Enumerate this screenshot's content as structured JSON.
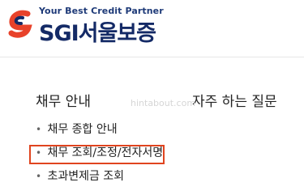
{
  "brand": {
    "tagline": "Your Best Credit Partner",
    "name": "SGI서울보증",
    "colors": {
      "primary": "#142a66",
      "accent": "#e8422a"
    }
  },
  "main": {
    "menu_title": "채무 안내",
    "faq_title": "자주 하는 질문",
    "menu_items": [
      {
        "label": "채무 종합 안내",
        "highlighted": false
      },
      {
        "label": "채무 조회/조정/전자서명",
        "highlighted": true
      },
      {
        "label": "초과변제금 조회",
        "highlighted": false
      }
    ]
  },
  "watermark": "hintabout.com",
  "highlight_color": "#e0441f"
}
